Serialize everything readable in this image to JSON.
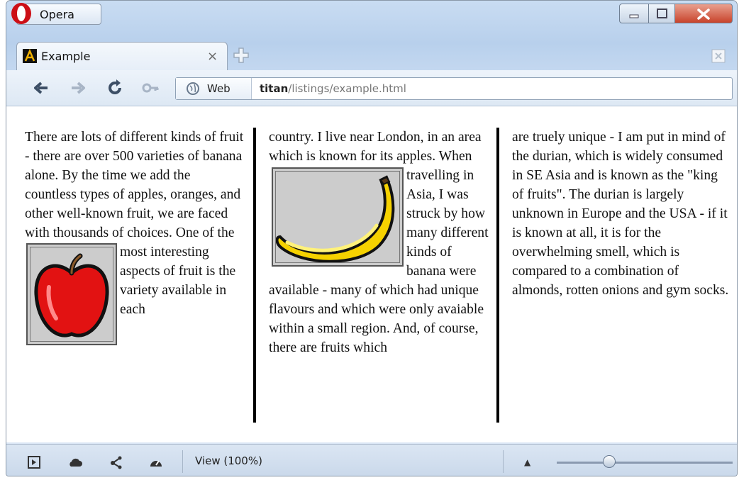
{
  "browser": {
    "menu_button_label": "Opera",
    "tab": {
      "title": "Example",
      "close_glyph": "×"
    },
    "address": {
      "web_label": "Web",
      "url_host": "titan",
      "url_path": "/listings/example.html"
    },
    "status": {
      "view_label": "View (100%)"
    },
    "colors": {
      "frame": "#c9dcf2",
      "opera_red": "#cc0f16",
      "close_red": "#c8432b"
    },
    "zoom_level": 0.3,
    "icons": [
      "opera-logo-icon",
      "minimize-icon",
      "maximize-icon",
      "close-icon",
      "favicon-icon",
      "new-tab-icon",
      "trash-icon",
      "back-icon",
      "forward-icon",
      "reload-icon",
      "key-icon",
      "web-icon",
      "panel-icon",
      "cloud-icon",
      "share-icon",
      "speed-icon",
      "zoom-up-icon"
    ]
  },
  "page": {
    "col1_text": "There are lots of different kinds of fruit - there are over 500 varieties of banana alone. By the time we add the countless types of apples, oranges, and other well-known fruit, we are faced with thousands of choices.",
    "col1_text2": "One of the most interesting aspects of fruit is the variety available in each",
    "col2_text": "country. I live near London, in an area which is known for its",
    "col2_text2": "apples. When travelling in Asia, I was struck by how many different kinds of banana were available - many of which had unique flavours and which were only avaiable within a small region. And, of course, there are fruits which",
    "col3_text": "are truely unique - I am put in mind of the durian, which is widely consumed in SE Asia and is known as the \"king of fruits\". The durian is largely unknown in Europe and the USA - if it is known at all, it is for the overwhelming smell, which is compared to a combination of almonds, rotten onions and gym socks."
  }
}
